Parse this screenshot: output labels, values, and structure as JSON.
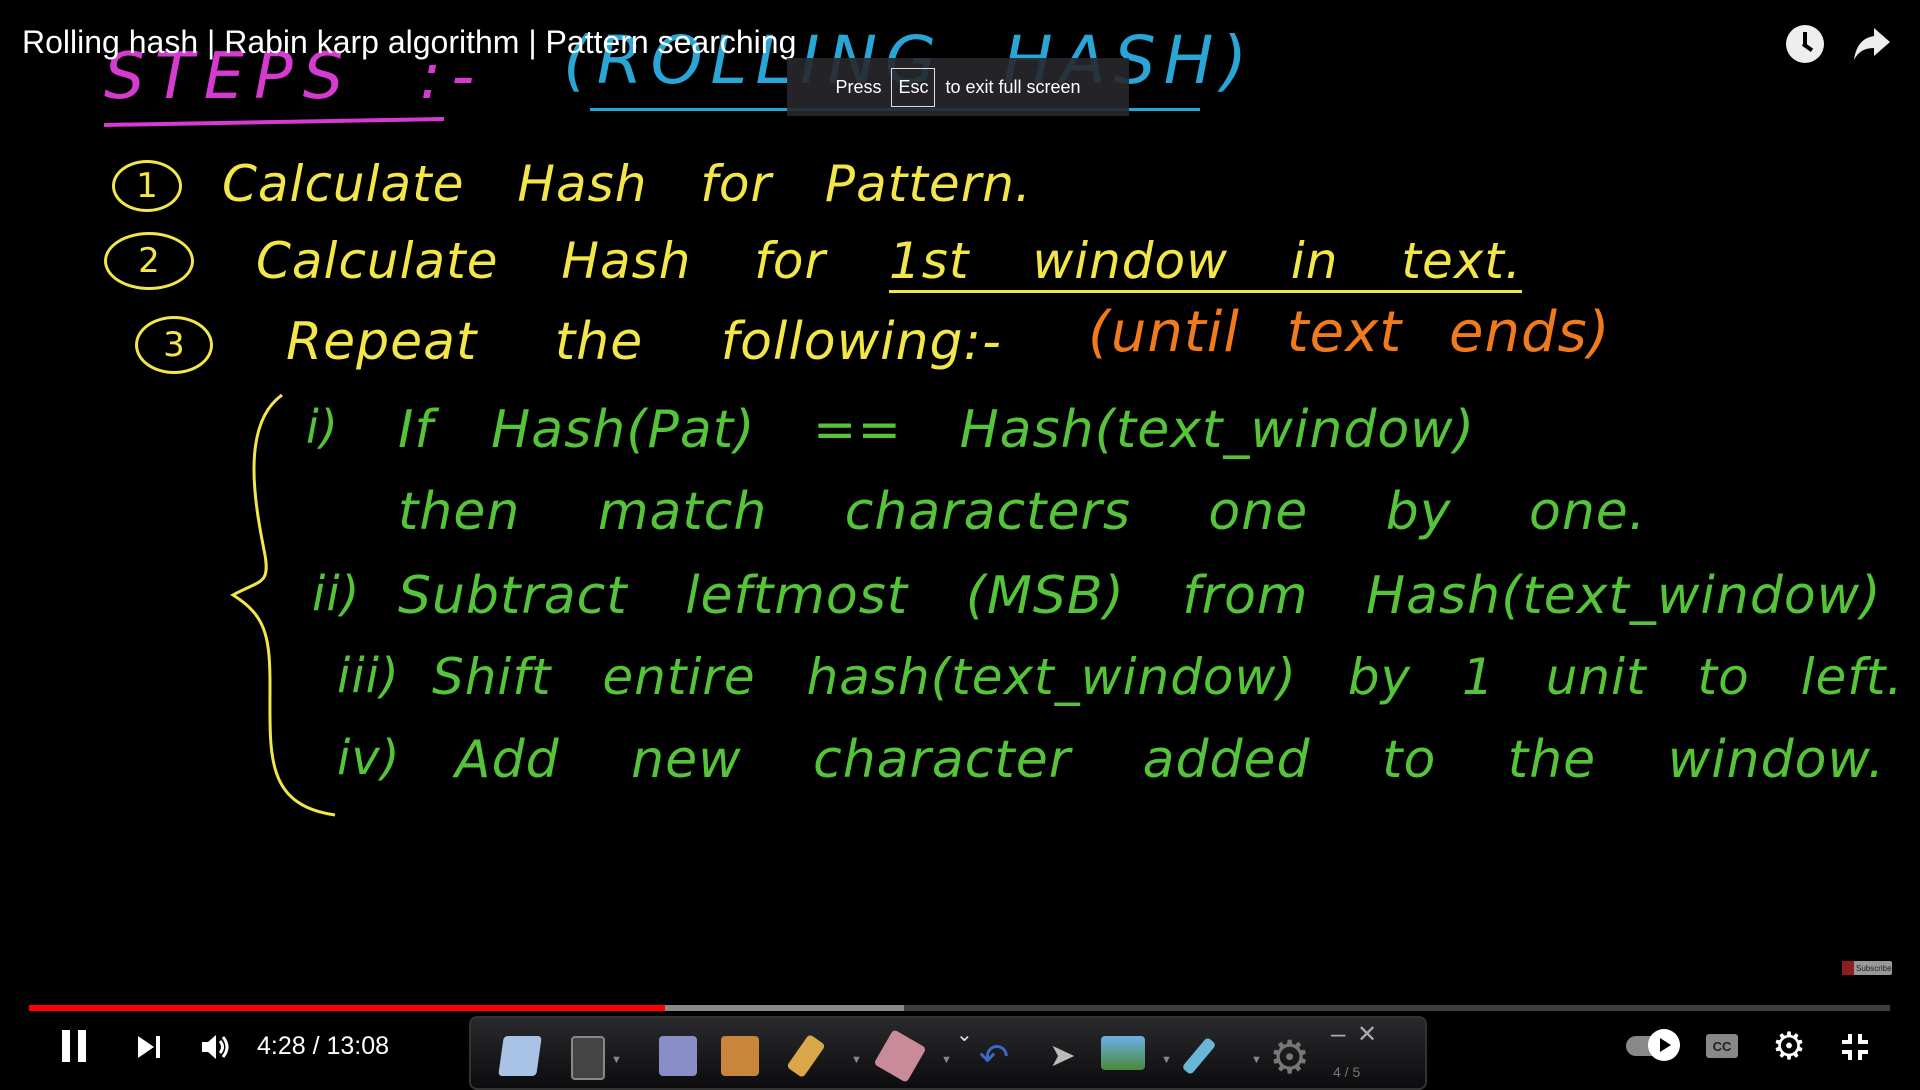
{
  "video": {
    "title": "Rolling hash | Rabin karp algorithm | Pattern searching",
    "fullscreen_toast": {
      "press": "Press",
      "key": "Esc",
      "rest": "to exit full screen"
    },
    "current_time": "4:28",
    "duration": "13:08",
    "time_display": "4:28 / 13:08",
    "progress_fraction": 0.342,
    "buffered_fraction": 0.47,
    "subscribe_watermark": "Subscribe",
    "page_indicator": "4 / 5"
  },
  "board": {
    "heading": "STEPS :-",
    "heading2": "(ROLLING HASH)",
    "steps": [
      {
        "num": "1",
        "text": "Calculate Hash for Pattern."
      },
      {
        "num": "2",
        "text_a": "Calculate Hash for",
        "text_b": "1st window in text."
      },
      {
        "num": "3",
        "text": "Repeat the following:-",
        "note": "(until text ends)"
      }
    ],
    "substeps": [
      {
        "num": "i)",
        "text": "If Hash(Pat) == Hash(text_window)",
        "text2": "then match characters one by one."
      },
      {
        "num": "ii)",
        "text": "Subtract leftmost (MSB) from Hash(text_window)"
      },
      {
        "num": "iii)",
        "text": "Shift entire hash(text_window) by 1 unit to left."
      },
      {
        "num": "iv)",
        "text": "Add new character added to the window."
      }
    ]
  },
  "colors": {
    "progress": "#ff0000",
    "steps": "#f2e64a",
    "substeps": "#55c43a",
    "note": "#f07a1c",
    "heading": "#d63ad0",
    "heading2": "#2aa6d6"
  }
}
